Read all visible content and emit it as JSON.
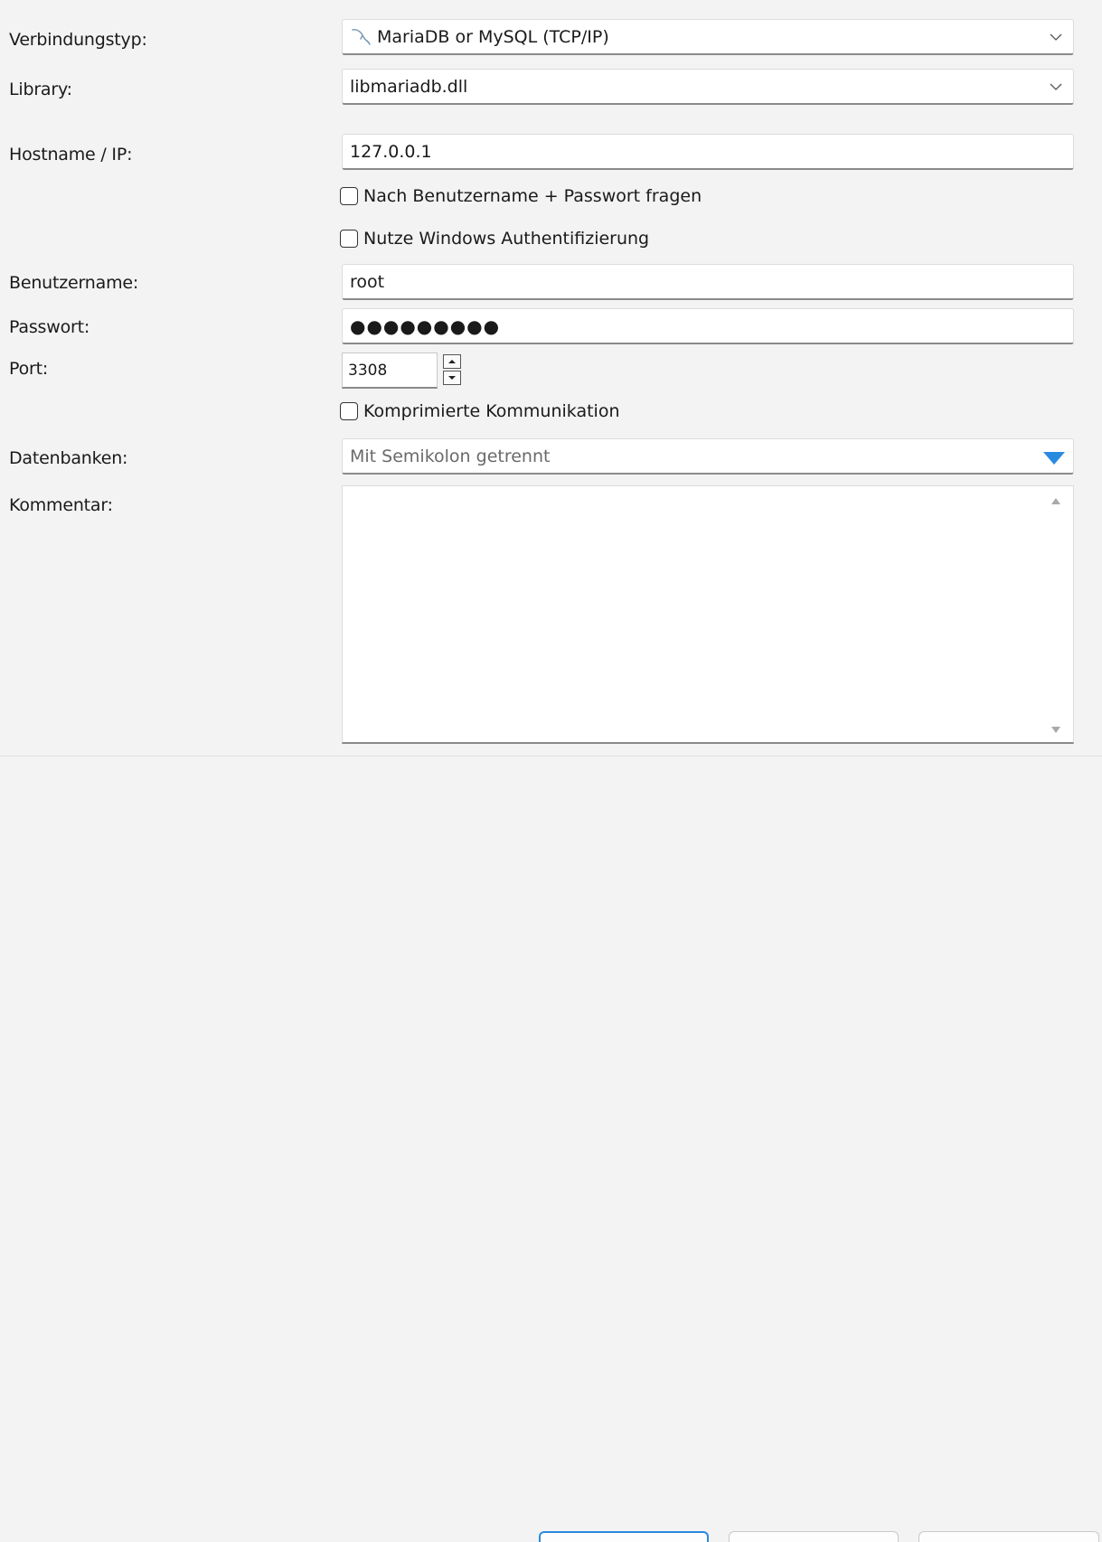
{
  "form": {
    "connection_type": {
      "label": "Verbindungstyp:",
      "value": "MariaDB or MySQL (TCP/IP)",
      "icon": "dolphin-icon"
    },
    "library": {
      "label": "Library:",
      "value": "libmariadb.dll"
    },
    "hostname": {
      "label": "Hostname / IP:",
      "value": "127.0.0.1"
    },
    "ask_credentials": {
      "label": "Nach Benutzername + Passwort fragen",
      "checked": false
    },
    "windows_auth": {
      "label": "Nutze Windows Authentifizierung",
      "checked": false
    },
    "username": {
      "label": "Benutzername:",
      "value": "root"
    },
    "password": {
      "label": "Passwort:",
      "value": "●●●●●●●●●"
    },
    "port": {
      "label": "Port:",
      "value": "3308"
    },
    "compressed": {
      "label": "Komprimierte Kommunikation",
      "checked": false
    },
    "databases": {
      "label": "Datenbanken:",
      "placeholder": "Mit Semikolon getrennt"
    },
    "comment": {
      "label": "Kommentar:",
      "value": ""
    }
  },
  "colors": {
    "accent": "#2a8ae0",
    "background": "#f3f3f3"
  }
}
